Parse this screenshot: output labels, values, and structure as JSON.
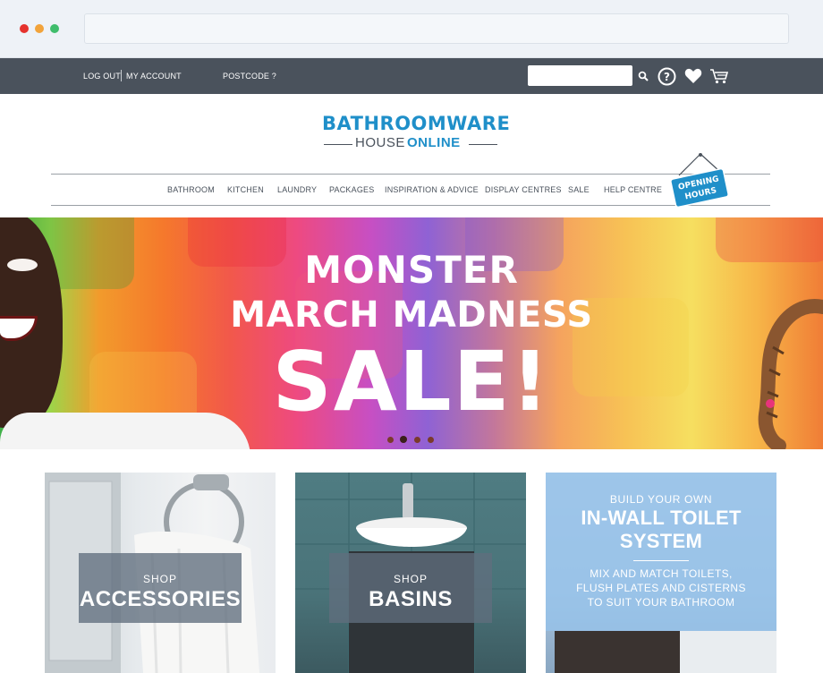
{
  "topbar": {
    "logout": "LOG OUT",
    "account": "MY ACCOUNT",
    "postcode": "POSTCODE ?",
    "search_placeholder": ""
  },
  "logo": {
    "top": "BATHROOMWARE",
    "house": "HOUSE",
    "online": "ONLINE"
  },
  "nav": {
    "items": [
      "BATHROOM",
      "KITCHEN",
      "LAUNDRY",
      "PACKAGES",
      "INSPIRATION & ADVICE",
      "DISPLAY CENTRES",
      "SALE",
      "HELP CENTRE"
    ],
    "opening_line1": "OPENING",
    "opening_line2": "HOURS"
  },
  "hero": {
    "line1": "MONSTER",
    "line2": "MARCH MADNESS",
    "line3": "SALE!",
    "slides": 4,
    "active_slide": 2
  },
  "tiles": {
    "accessories": {
      "kicker": "SHOP",
      "title": "ACCESSORIES"
    },
    "basins": {
      "kicker": "SHOP",
      "title": "BASINS"
    },
    "inwall": {
      "kicker": "BUILD YOUR OWN",
      "title_line1": "IN-WALL TOILET",
      "title_line2": "SYSTEM",
      "desc_line1": "MIX AND MATCH TOILETS,",
      "desc_line2": "FLUSH PLATES AND CISTERNS",
      "desc_line3": "TO SUIT YOUR BATHROOM"
    }
  },
  "colors": {
    "brand_blue": "#1f8fc9",
    "topbar": "#4a525c"
  },
  "icons": [
    "search-icon",
    "help-icon",
    "heart-icon",
    "cart-icon"
  ]
}
